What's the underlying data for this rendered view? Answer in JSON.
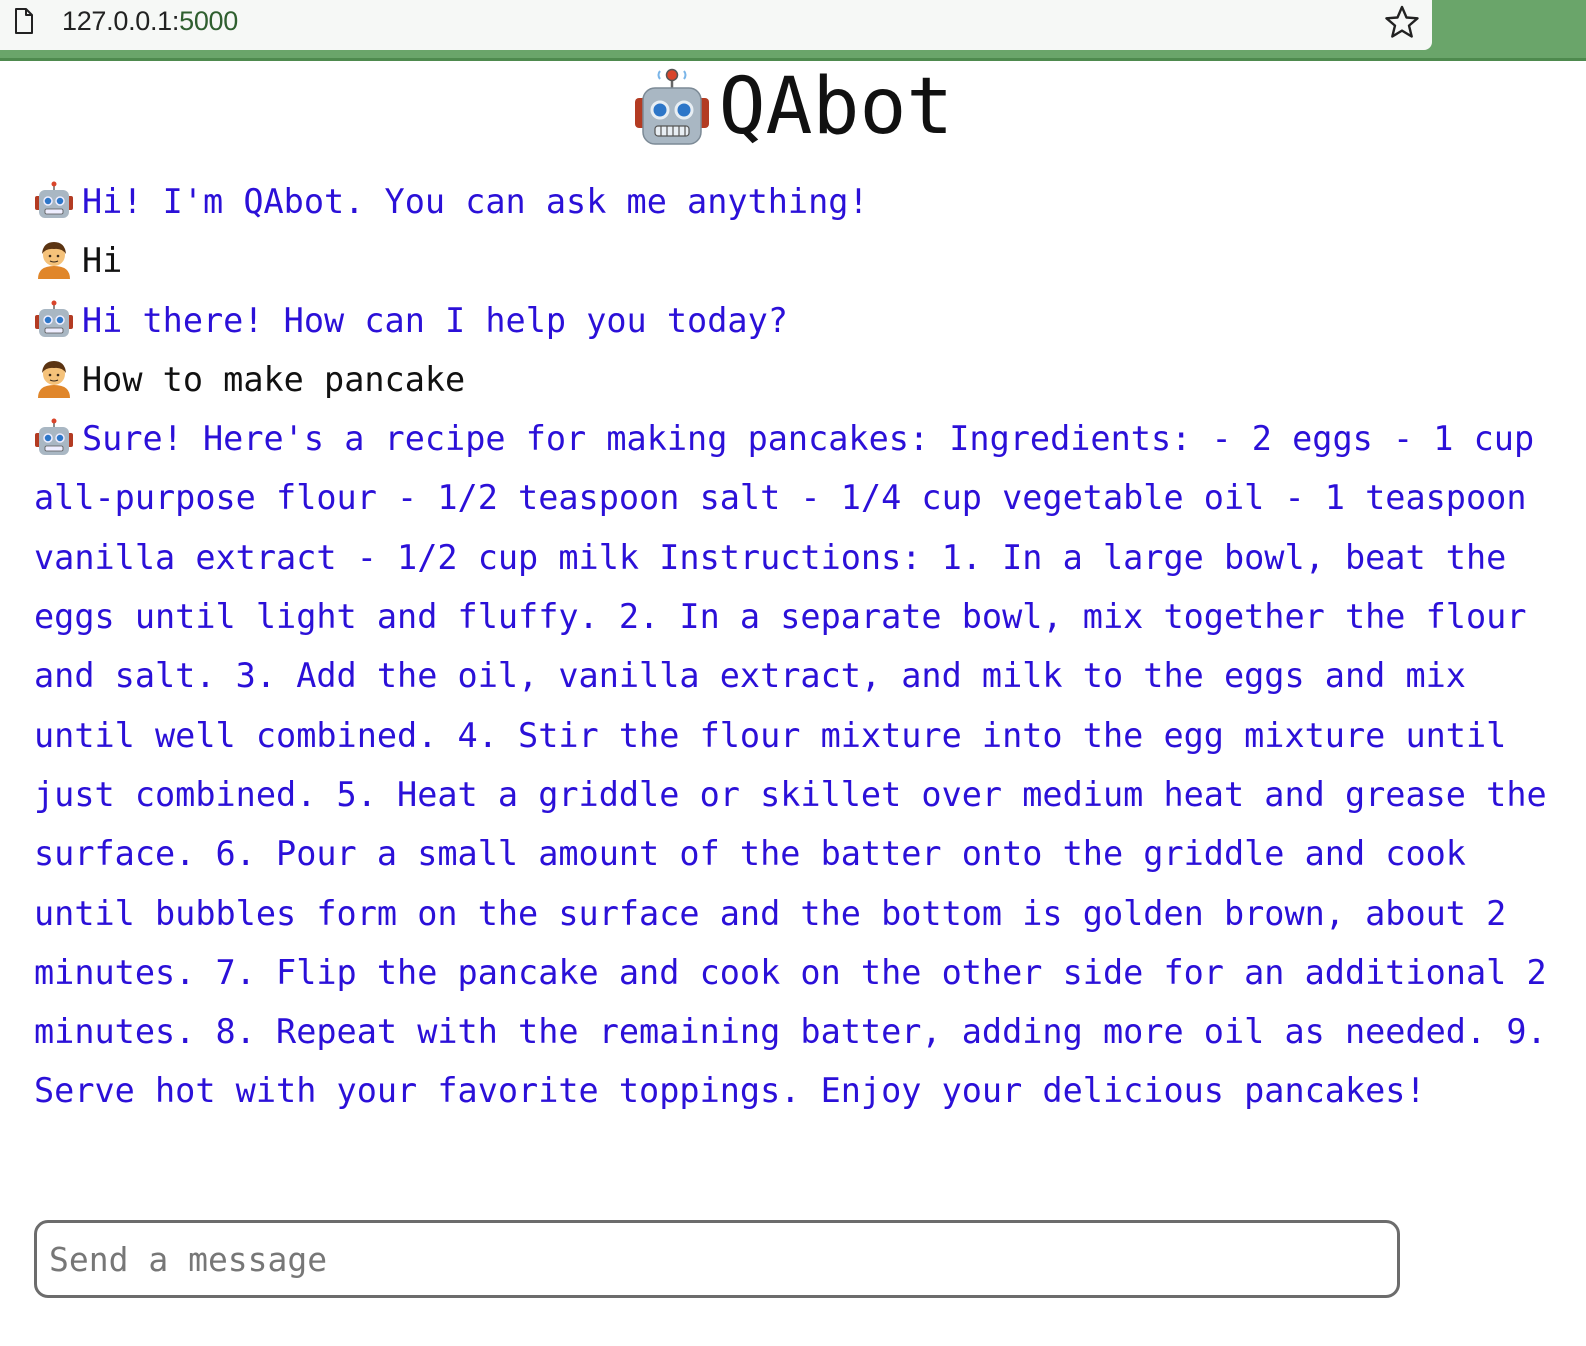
{
  "browser": {
    "url_host": "127.0.0.1:",
    "url_port": "5000",
    "page_icon": "page-icon",
    "bookmark_icon": "star-icon"
  },
  "app": {
    "title": "QAbot",
    "title_icon": "robot-icon"
  },
  "chat": {
    "messages": [
      {
        "role": "bot",
        "avatar": "robot-icon",
        "text": "Hi! I'm QAbot. You can ask me anything!"
      },
      {
        "role": "user",
        "avatar": "person-icon",
        "text": "Hi"
      },
      {
        "role": "bot",
        "avatar": "robot-icon",
        "text": "Hi there! How can I help you today?"
      },
      {
        "role": "user",
        "avatar": "person-icon",
        "text": "How to make pancake"
      },
      {
        "role": "bot",
        "avatar": "robot-icon",
        "text": "Sure! Here's a recipe for making pancakes: Ingredients: - 2 eggs - 1 cup all-purpose flour - 1/2 teaspoon salt - 1/4 cup vegetable oil - 1 teaspoon vanilla extract - 1/2 cup milk Instructions: 1. In a large bowl, beat the eggs until light and fluffy. 2. In a separate bowl, mix together the flour and salt. 3. Add the oil, vanilla extract, and milk to the eggs and mix until well combined. 4. Stir the flour mixture into the egg mixture until just combined. 5. Heat a griddle or skillet over medium heat and grease the surface. 6. Pour a small amount of the batter onto the griddle and cook until bubbles form on the surface and the bottom is golden brown, about 2 minutes. 7. Flip the pancake and cook on the other side for an additional 2 minutes. 8. Repeat with the remaining batter, adding more oil as needed. 9. Serve hot with your favorite toppings. Enjoy your delicious pancakes!"
      }
    ],
    "input": {
      "placeholder": "Send a message",
      "value": ""
    }
  },
  "colors": {
    "bot_text": "#2b10d8",
    "user_text": "#111111",
    "chrome_green": "#6aa56a"
  }
}
